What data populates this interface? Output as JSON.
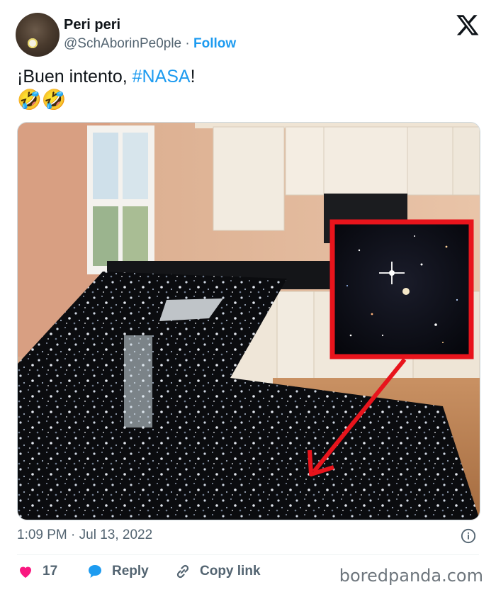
{
  "author": {
    "display_name": "Peri peri",
    "handle": "@SchAborinPe0ple",
    "separator": "·",
    "follow_label": "Follow"
  },
  "tweet": {
    "text_before": "¡Buen intento, ",
    "hashtag": "#NASA",
    "text_after": "!",
    "emoji_line": "🤣🤣"
  },
  "media": {
    "description_icon": "kitchen-photo-with-galaxy-inset"
  },
  "footer": {
    "timestamp": "1:09 PM · Jul 13, 2022",
    "like_count": "17",
    "reply_label": "Reply",
    "copy_link_label": "Copy link"
  },
  "watermark": "boredpanda.com",
  "colors": {
    "accent": "#1d9bf0",
    "heart": "#f91880",
    "highlight_box": "#e8141c"
  }
}
